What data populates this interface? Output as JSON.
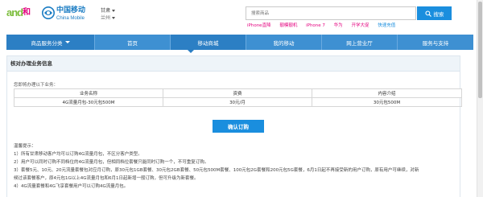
{
  "header": {
    "and_logo_text": "and",
    "and_logo_char": "和",
    "brand_cn": "中国移动",
    "brand_en": "China Mobile",
    "region": {
      "province": "甘肃",
      "city": "兰州"
    },
    "search": {
      "placeholder": "搜索商品",
      "button_label": "搜索"
    },
    "hot_words": [
      {
        "label": "iPhone直降",
        "color": "#e4007f"
      },
      {
        "label": "靓模靓机",
        "color": "#e4007f"
      },
      {
        "label": "iPhone 7",
        "color": "#e4007f"
      },
      {
        "label": "华为",
        "color": "#e4007f"
      },
      {
        "label": "开学大促",
        "color": "#e4007f"
      },
      {
        "label": "快速充值",
        "color": "#1a8ede"
      }
    ]
  },
  "nav": {
    "items": [
      {
        "label": "商品服务分类"
      },
      {
        "label": "首页"
      },
      {
        "label": "移动商城"
      },
      {
        "label": "我的移动"
      },
      {
        "label": "网上营业厅"
      },
      {
        "label": "服务与支持"
      }
    ],
    "active_index": 2
  },
  "panel": {
    "title": "核对办理业务信息",
    "prompt": "您即将办理以下业务：",
    "table": {
      "headers": [
        "业务名称",
        "资费",
        "内容介绍"
      ],
      "rows": [
        [
          "4G流量月包-30元包500M",
          "30元/月",
          "30元包500M"
        ]
      ]
    },
    "confirm_label": "确认订购",
    "notes": [
      "温馨提示：",
      "1）所有甘肃移动客户均可以订购4G流量月包，不区分客户类型。",
      "2）用户可以同时订购不同档位的4G流量月包，但相同档位套餐只能同时订购一个，不可重复订购。",
      "3）套餐5元、10元、20元流量套餐包对应月订购，原30元包1GB套餐、30元包2GB套餐、50元包500M套餐、100元包2G套餐和200元包5G套餐，6月1日起不再接受新的用户订购，原有用户可继续，对新",
      "候过该套餐客户，原4元包1G以上4G流量月包和6月1日起新增一般订购，但可升级为新套餐。",
      "4）4G流量套餐和4G飞享套餐用户可以订购4G流量月包。"
    ]
  },
  "colors": {
    "nav_bg": "#3e90d2",
    "nav_active": "#2c7fc4",
    "primary_button": "#1a8ede",
    "brand_blue": "#1a7cc3",
    "and_green": "#7cbd3c",
    "and_magenta": "#e3007f"
  },
  "icons": {
    "search": "search-icon",
    "dropdown": "chevron-down-icon",
    "logo": "china-mobile-logo-icon"
  }
}
